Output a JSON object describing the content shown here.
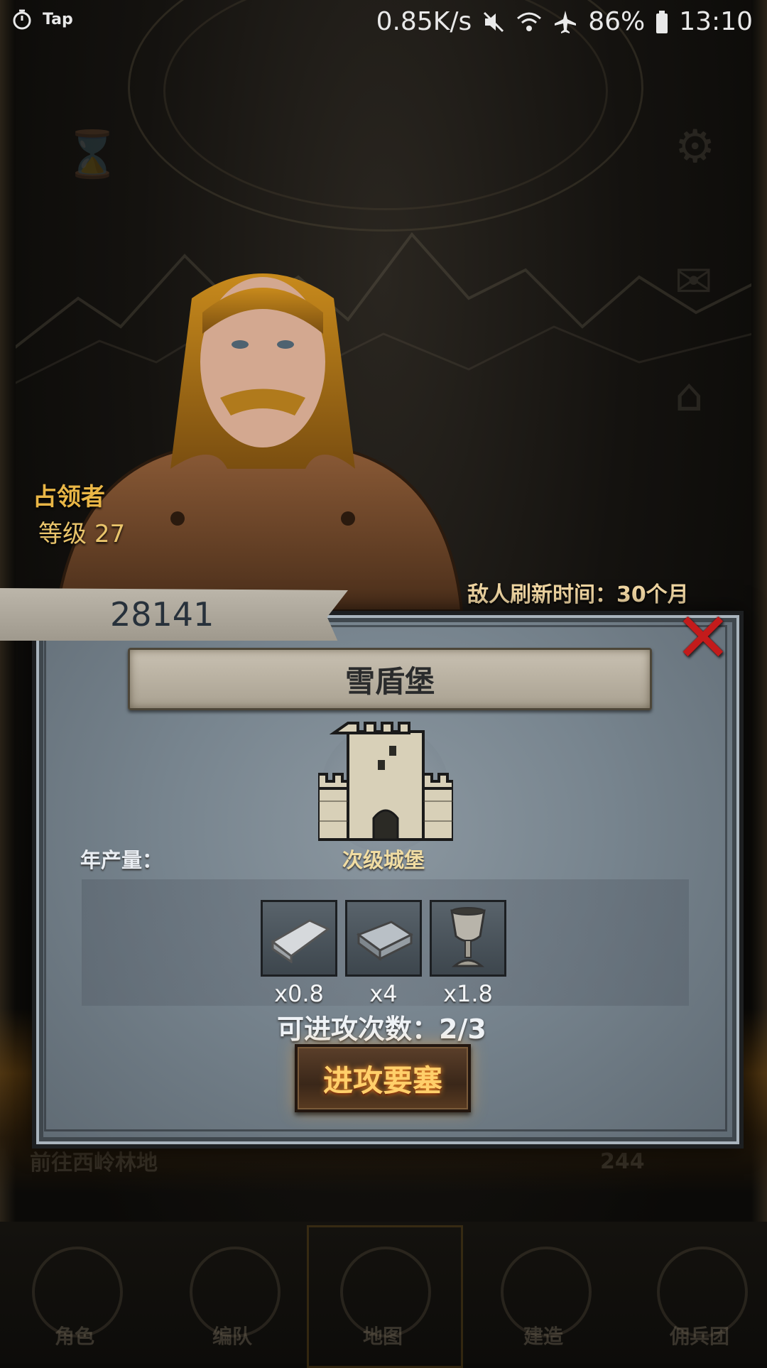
{
  "status_bar": {
    "app_label": "Tap",
    "net_speed": "0.85K/s",
    "battery": "86%",
    "time": "13:10"
  },
  "background": {
    "bottom_left_text": "前往西岭林地",
    "bottom_right_value": "244",
    "tabs": [
      "角色",
      "编队",
      "地图",
      "建造",
      "佣兵团"
    ]
  },
  "occupier": {
    "title": "占领者",
    "level_label": "等级",
    "level_value": "27"
  },
  "refresh_time": "敌人刷新时间：30个月",
  "power": "28141",
  "dialog": {
    "castle_name": "雪盾堡",
    "castle_type": "次级城堡",
    "yield_label": "年产量：",
    "resources": [
      {
        "icon": "silver-ingot-icon",
        "qty": "x0.8"
      },
      {
        "icon": "iron-ingot-icon",
        "qty": "x4"
      },
      {
        "icon": "silver-chalice-icon",
        "qty": "x1.8"
      }
    ],
    "attempts": "可进攻次数：2/3",
    "attack_label": "进攻要塞",
    "close_glyph": "✕"
  },
  "colors": {
    "accent_gold": "#e9b646",
    "close_red": "#c31b1b",
    "panel_steel": "#77848e",
    "attack_text": "#ffcf6a"
  }
}
